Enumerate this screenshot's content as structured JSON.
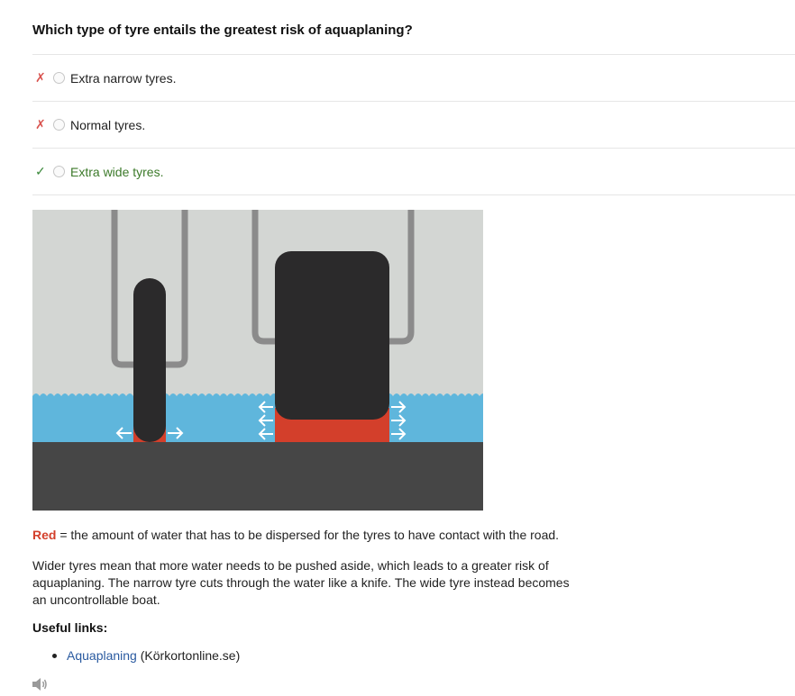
{
  "question": "Which type of tyre entails the greatest risk of aquaplaning?",
  "options": [
    {
      "mark": "✗",
      "label": "Extra narrow tyres.",
      "correct": false
    },
    {
      "mark": "✗",
      "label": "Normal tyres.",
      "correct": false
    },
    {
      "mark": "✓",
      "label": "Extra wide tyres.",
      "correct": true
    }
  ],
  "explanation": {
    "red_word": "Red",
    "red_note": " = the amount of water that has to be dispersed for the tyres to have contact with the road.",
    "body": "Wider tyres mean that more water needs to be pushed aside, which leads to a greater risk of aquaplaning. The narrow tyre cuts through the water like a knife. The wide tyre instead becomes an uncontrollable boat."
  },
  "useful_links": {
    "title": "Useful links:",
    "items": [
      {
        "text": "Aquaplaning",
        "suffix": " (Körkortonline.se)"
      }
    ]
  },
  "icons": {
    "speaker": "speaker-icon"
  },
  "colors": {
    "wrong": "#d9534f",
    "correct": "#3c7a2a",
    "red_highlight": "#d33f2b",
    "water": "#5fb6dc",
    "road": "#464646",
    "tyre": "#2b2a2b",
    "background": "#d3d6d3"
  }
}
